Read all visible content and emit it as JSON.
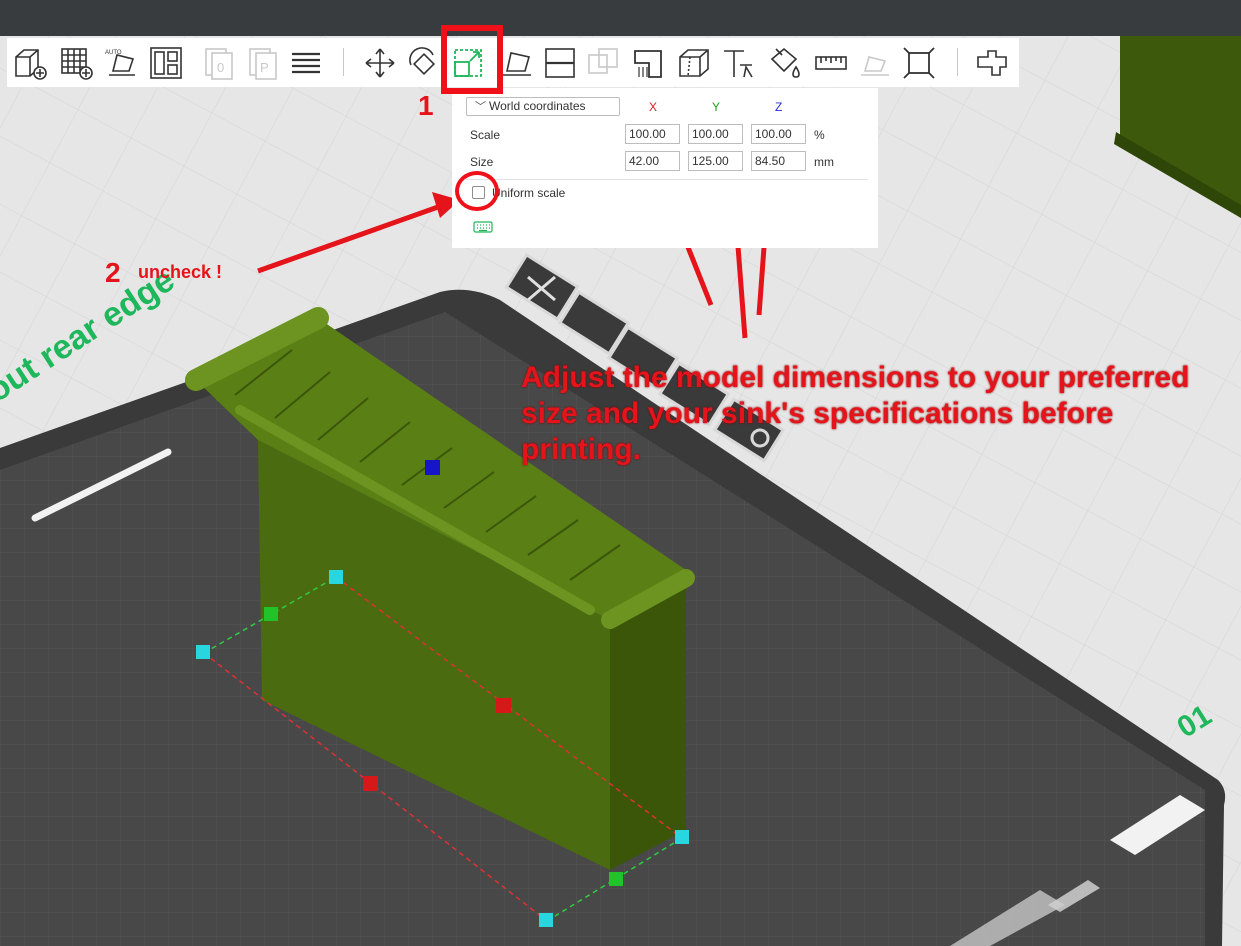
{
  "toolbar": {
    "icons": [
      "add-object-icon",
      "add-plate-icon",
      "auto-orient-icon",
      "arrange-icon",
      "copy-icon",
      "paste-icon",
      "layers-list-icon",
      "move-icon",
      "rotate-icon",
      "scale-icon",
      "lay-on-face-icon",
      "cut-icon",
      "boolean-icon",
      "support-paint-icon",
      "seam-paint-icon",
      "text-icon",
      "color-paint-icon",
      "measure-icon",
      "assembly-icon",
      "fit-icon",
      "split-icon"
    ]
  },
  "scale_panel": {
    "coordinate_system": "World coordinates",
    "axis_x": "X",
    "axis_y": "Y",
    "axis_z": "Z",
    "scale_label": "Scale",
    "size_label": "Size",
    "scale_x": "100.00",
    "scale_y": "100.00",
    "scale_z": "100.00",
    "scale_unit": "%",
    "size_x": "42.00",
    "size_y": "125.00",
    "size_z": "84.50",
    "size_unit": "mm",
    "uniform_scale_label": "Uniform scale",
    "uniform_scale_checked": false
  },
  "annotations": {
    "step1": "1",
    "step2": "2",
    "uncheck_text": "uncheck !",
    "instruction": "Adjust the model dimensions to your preferred size and your sink's specifications before printing."
  },
  "bed": {
    "rear_edge_text": "out rear edge",
    "plate_number": "01"
  },
  "colors": {
    "accent_red": "#e5141b",
    "model_green": "#4a6b10",
    "bed_green": "#1fb75b",
    "axis_x": "#d62020",
    "axis_y": "#1e9e1e",
    "axis_z": "#2a2ad6"
  }
}
